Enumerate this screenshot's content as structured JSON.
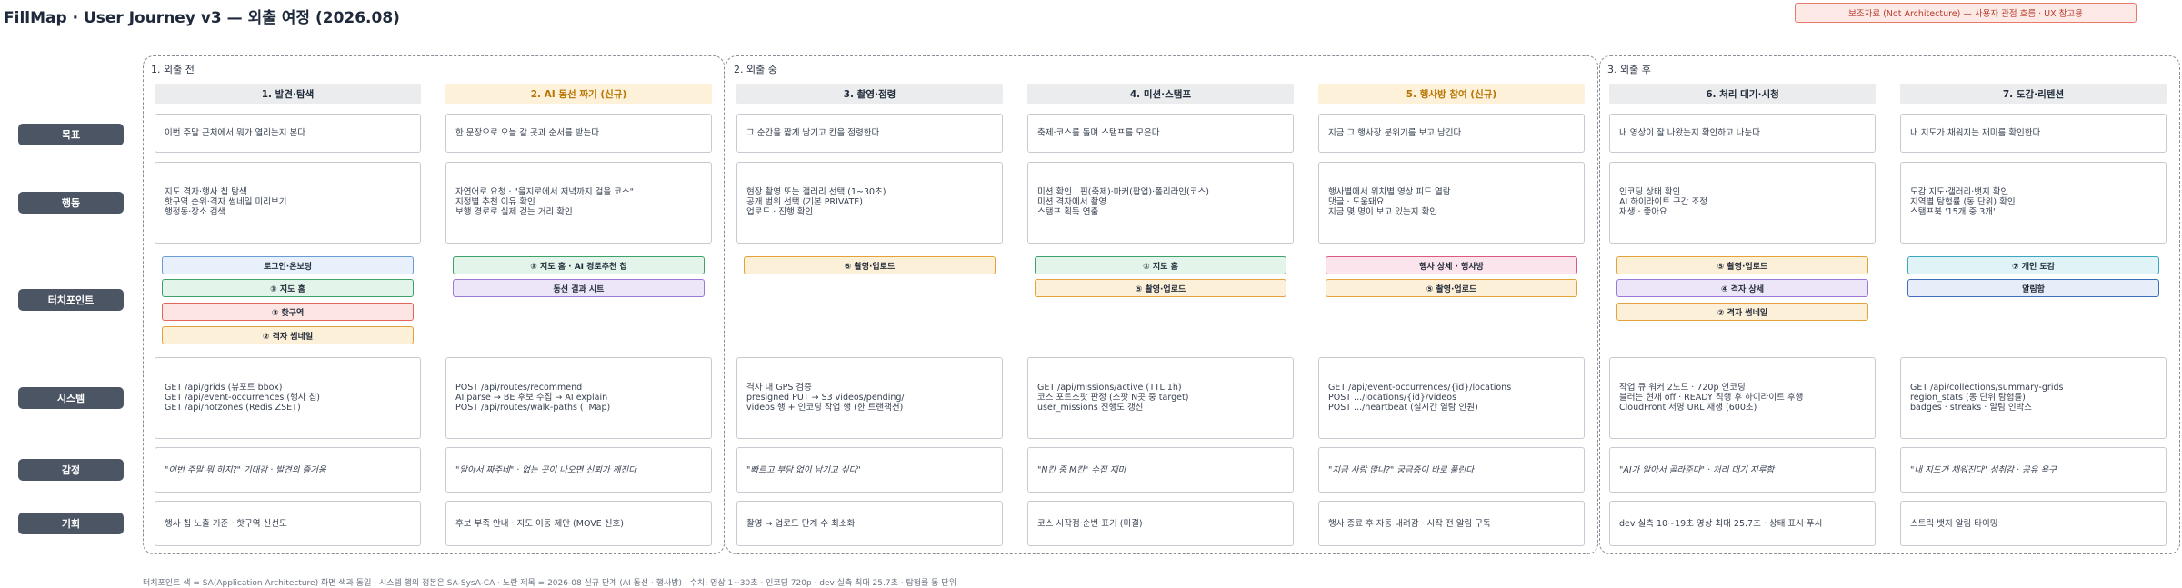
{
  "title": "FillMap · User Journey v3 — 외출 여정 (2026.08)",
  "badge": "보조자료 (Not Architecture) — 사용자 관점 흐름 · UX 참고용",
  "stages": [
    {
      "label": "1. 외출 전"
    },
    {
      "label": "2. 외출 중"
    },
    {
      "label": "3. 외출 후"
    }
  ],
  "row_labels": {
    "goal": "목표",
    "action": "행동",
    "touchpoint": "터치포인트",
    "system": "시스템",
    "emotion": "감정",
    "opportunity": "기회"
  },
  "columns": [
    {
      "title": "1. 발견·탐색",
      "is_new": false,
      "goal": "이번 주말 근처에서 뭐가 열리는지 본다",
      "action": [
        "지도 격자·행사 칩 탐색",
        "핫구역 순위·격자 썸네일 미리보기",
        "행정동·장소 검색"
      ],
      "touchpoints": [
        {
          "label": "로그인·온보딩",
          "color": "blue"
        },
        {
          "label": "① 지도 홈",
          "color": "green"
        },
        {
          "label": "③ 핫구역",
          "color": "red"
        },
        {
          "label": "② 격자 썸네일",
          "color": "orange"
        }
      ],
      "system": [
        "GET /api/grids (뷰포트 bbox)",
        "GET /api/event-occurrences (행사 칩)",
        "GET /api/hotzones (Redis ZSET)"
      ],
      "emotion": "\"이번 주말 뭐 하지?\" 기대감 · 발견의 즐거움",
      "opportunity": "행사 칩 노출 기준 · 핫구역 신선도"
    },
    {
      "title": "2. AI 동선 짜기 (신규)",
      "is_new": true,
      "goal": "한 문장으로 오늘 갈 곳과 순서를 받는다",
      "action": [
        "자연어로 요청 · \"을지로에서 저녁까지 걸을 코스\"",
        "지정별 추천 이유 확인",
        "보행 경로로 실제 걷는 거리 확인"
      ],
      "touchpoints": [
        {
          "label": "① 지도 홈 · AI 경로추천 칩",
          "color": "green"
        },
        {
          "label": "동선 결과 시트",
          "color": "purple"
        }
      ],
      "system": [
        "POST /api/routes/recommend",
        "AI parse → BE 후보 수집 → AI explain",
        "POST /api/routes/walk-paths (TMap)"
      ],
      "emotion": "\"알아서 짜주네\" · 없는 곳이 나오면 신뢰가 깨진다",
      "opportunity": "후보 부족 안내 · 지도 이동 제안 (MOVE 신호)"
    },
    {
      "title": "3. 촬영·점령",
      "is_new": false,
      "goal": "그 순간을 짧게 남기고 칸을 점령한다",
      "action": [
        "현장 촬영 또는 갤러리 선택 (1~30초)",
        "공개 범위 선택 (기본 PRIVATE)",
        "업로드 · 진행 확인"
      ],
      "touchpoints": [
        {
          "label": "⑤ 촬영·업로드",
          "color": "orange"
        }
      ],
      "system": [
        "격자 내 GPS 검증",
        "presigned PUT → S3 videos/pending/",
        "videos 행 + 인코딩 작업 행 (한 트랜잭션)"
      ],
      "emotion": "\"빠르고 부담 없이 남기고 싶다\"",
      "opportunity": "촬영 → 업로드 단계 수 최소화"
    },
    {
      "title": "4. 미션·스탬프",
      "is_new": false,
      "goal": "축제·코스를 돌며 스탬프를 모은다",
      "action": [
        "미션 확인 · 핀(축제)·마커(팝업)·폴리라인(코스)",
        "미션 격자에서 촬영",
        "스탬프 획득 연출"
      ],
      "touchpoints": [
        {
          "label": "① 지도 홈",
          "color": "green"
        },
        {
          "label": "⑤ 촬영·업로드",
          "color": "orange"
        }
      ],
      "system": [
        "GET /api/missions/active (TTL 1h)",
        "코스 포트스팟 판정 (스팟 N곳 중 target)",
        "user_missions 진행도 갱신"
      ],
      "emotion": "\"N칸 중 M칸\" 수집 재미",
      "opportunity": "코스 시작점·순번 표기 (미결)"
    },
    {
      "title": "5. 행사방 참여 (신규)",
      "is_new": true,
      "goal": "지금 그 행사장 분위기를 보고 남긴다",
      "action": [
        "행사별에서 위치별 영상 피드 열람",
        "댓글 · 도움돼요",
        "지금 몇 명이 보고 있는지 확인"
      ],
      "touchpoints": [
        {
          "label": "행사 상세 · 행사방",
          "color": "pink"
        },
        {
          "label": "⑤ 촬영·업로드",
          "color": "orange"
        }
      ],
      "system": [
        "GET /api/event-occurrences/{id}/locations",
        "POST .../locations/{id}/videos",
        "POST .../heartbeat (실시간 열람 인원)"
      ],
      "emotion": "\"지금 사람 많나?\" 궁금증이 바로 풀린다",
      "opportunity": "행사 종료 후 자동 내려감 · 시작 전 알림 구독"
    },
    {
      "title": "6. 처리 대기·시청",
      "is_new": false,
      "goal": "내 영상이 잘 나왔는지 확인하고 나눈다",
      "action": [
        "인코딩 상태 확인",
        "AI 하이라이트 구간 조정",
        "재생 · 좋아요"
      ],
      "touchpoints": [
        {
          "label": "⑤ 촬영·업로드",
          "color": "orange"
        },
        {
          "label": "④ 격자 상세",
          "color": "purple"
        },
        {
          "label": "② 격자 썸네일",
          "color": "orange"
        }
      ],
      "system": [
        "작업 큐 워커 2노드 · 720p 인코딩",
        "블러는 현재 off · READY 직행 후 하이라이트 후행",
        "CloudFront 서명 URL 재생 (600초)"
      ],
      "emotion": "\"AI가 알아서 골라준다\" · 처리 대기 지루함",
      "opportunity": "dev 실측 10~19초 영상 최대 25.7초 · 상태 표시·푸시"
    },
    {
      "title": "7. 도감·리텐션",
      "is_new": false,
      "goal": "내 지도가 채워지는 재미를 확인한다",
      "action": [
        "도감 지도·갤러리·뱃지 확인",
        "지역별 탐험률 (동 단위) 확인",
        "스탬프북 '15개 중 3개'"
      ],
      "touchpoints": [
        {
          "label": "⑦ 개인 도감",
          "color": "cyan"
        },
        {
          "label": "알림함",
          "color": "dblue"
        }
      ],
      "system": [
        "GET /api/collections/summary-grids",
        "region_stats (동 단위 탐험률)",
        "badges · streaks · 알림 인박스"
      ],
      "emotion": "\"내 지도가 채워진다\" 성취감 · 공유 욕구",
      "opportunity": "스트릭·뱃지 알림 타이밍"
    }
  ],
  "footnote": "터치포인트 색 = SA(Application Architecture) 화면 색과 동일 · 시스템 행의 정본은 SA-SysA-CA · 노란 제목 = 2026-08 신규 단계 (AI 동선 · 행사방) · 수치: 영상 1~30초 · 인코딩 720p · dev 실측 최대 25.7초 · 탐험률 동 단위"
}
